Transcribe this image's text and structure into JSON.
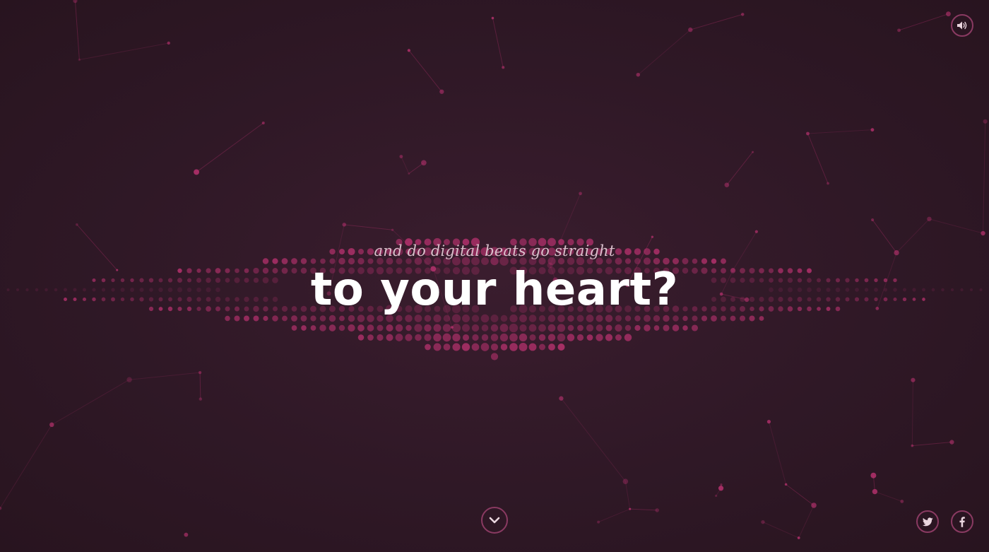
{
  "hero": {
    "subtitle": "and do digital beats go straight",
    "title": "to your heart?"
  },
  "controls": {
    "sound": {
      "icon": "speaker-volume-icon"
    },
    "scroll": {
      "icon": "chevron-down-icon"
    },
    "twitter": {
      "icon": "twitter-icon"
    },
    "facebook": {
      "icon": "facebook-icon"
    }
  },
  "colors": {
    "background": "#2f1826",
    "accent": "#b8326f",
    "button_border": "#8a3a62",
    "subtitle_text": "#d9bfcb",
    "title_text": "#ffffff"
  }
}
